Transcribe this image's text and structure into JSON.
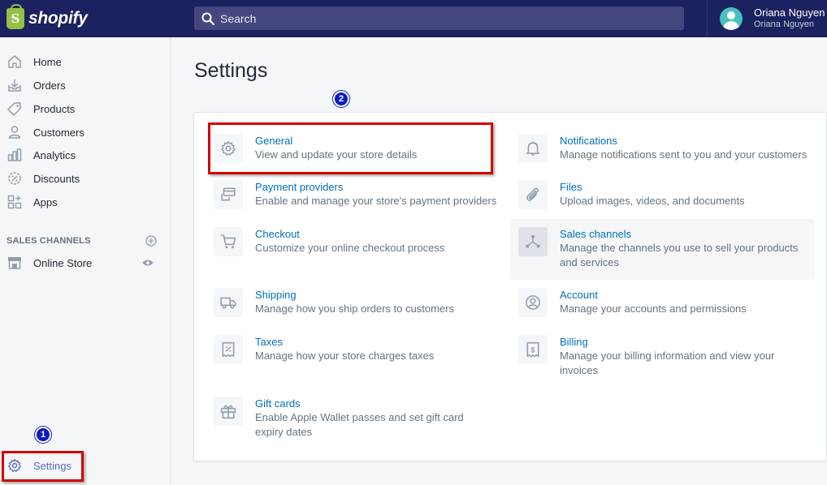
{
  "brand": {
    "logo_letter": "S",
    "name": "shopify"
  },
  "search": {
    "placeholder": "Search"
  },
  "user": {
    "name": "Oriana Nguyen",
    "store": "Oriana Nguyen"
  },
  "sidebar": {
    "items": [
      {
        "label": "Home",
        "icon": "home-icon"
      },
      {
        "label": "Orders",
        "icon": "orders-icon"
      },
      {
        "label": "Products",
        "icon": "tag-icon"
      },
      {
        "label": "Customers",
        "icon": "customer-icon"
      },
      {
        "label": "Analytics",
        "icon": "analytics-icon"
      },
      {
        "label": "Discounts",
        "icon": "discount-icon"
      },
      {
        "label": "Apps",
        "icon": "apps-icon"
      }
    ],
    "sales_channels_header": "SALES CHANNELS",
    "channels": [
      {
        "label": "Online Store",
        "icon": "store-icon"
      }
    ],
    "settings_label": "Settings"
  },
  "page": {
    "title": "Settings"
  },
  "settings": {
    "left": [
      {
        "title": "General",
        "desc": "View and update your store details",
        "icon": "gear-icon"
      },
      {
        "title": "Payment providers",
        "desc": "Enable and manage your store's payment providers",
        "icon": "payment-icon"
      },
      {
        "title": "Checkout",
        "desc": "Customize your online checkout process",
        "icon": "cart-icon"
      },
      {
        "title": "Shipping",
        "desc": "Manage how you ship orders to customers",
        "icon": "truck-icon"
      },
      {
        "title": "Taxes",
        "desc": "Manage how your store charges taxes",
        "icon": "tax-icon"
      },
      {
        "title": "Gift cards",
        "desc": "Enable Apple Wallet passes and set gift card expiry dates",
        "icon": "gift-icon"
      }
    ],
    "right": [
      {
        "title": "Notifications",
        "desc": "Manage notifications sent to you and your customers",
        "icon": "bell-icon"
      },
      {
        "title": "Files",
        "desc": "Upload images, videos, and documents",
        "icon": "paperclip-icon"
      },
      {
        "title": "Sales channels",
        "desc": "Manage the channels you use to sell your products and services",
        "icon": "channels-icon"
      },
      {
        "title": "Account",
        "desc": "Manage your accounts and permissions",
        "icon": "account-icon"
      },
      {
        "title": "Billing",
        "desc": "Manage your billing information and view your invoices",
        "icon": "billing-icon"
      }
    ]
  },
  "annotations": {
    "step1": "1",
    "step2": "2"
  },
  "colors": {
    "topbar": "#1c2260",
    "link": "#006fbb",
    "accent": "#5c6ac4",
    "annotation_red": "#d40000",
    "annotation_blue": "#0b1cc2"
  }
}
